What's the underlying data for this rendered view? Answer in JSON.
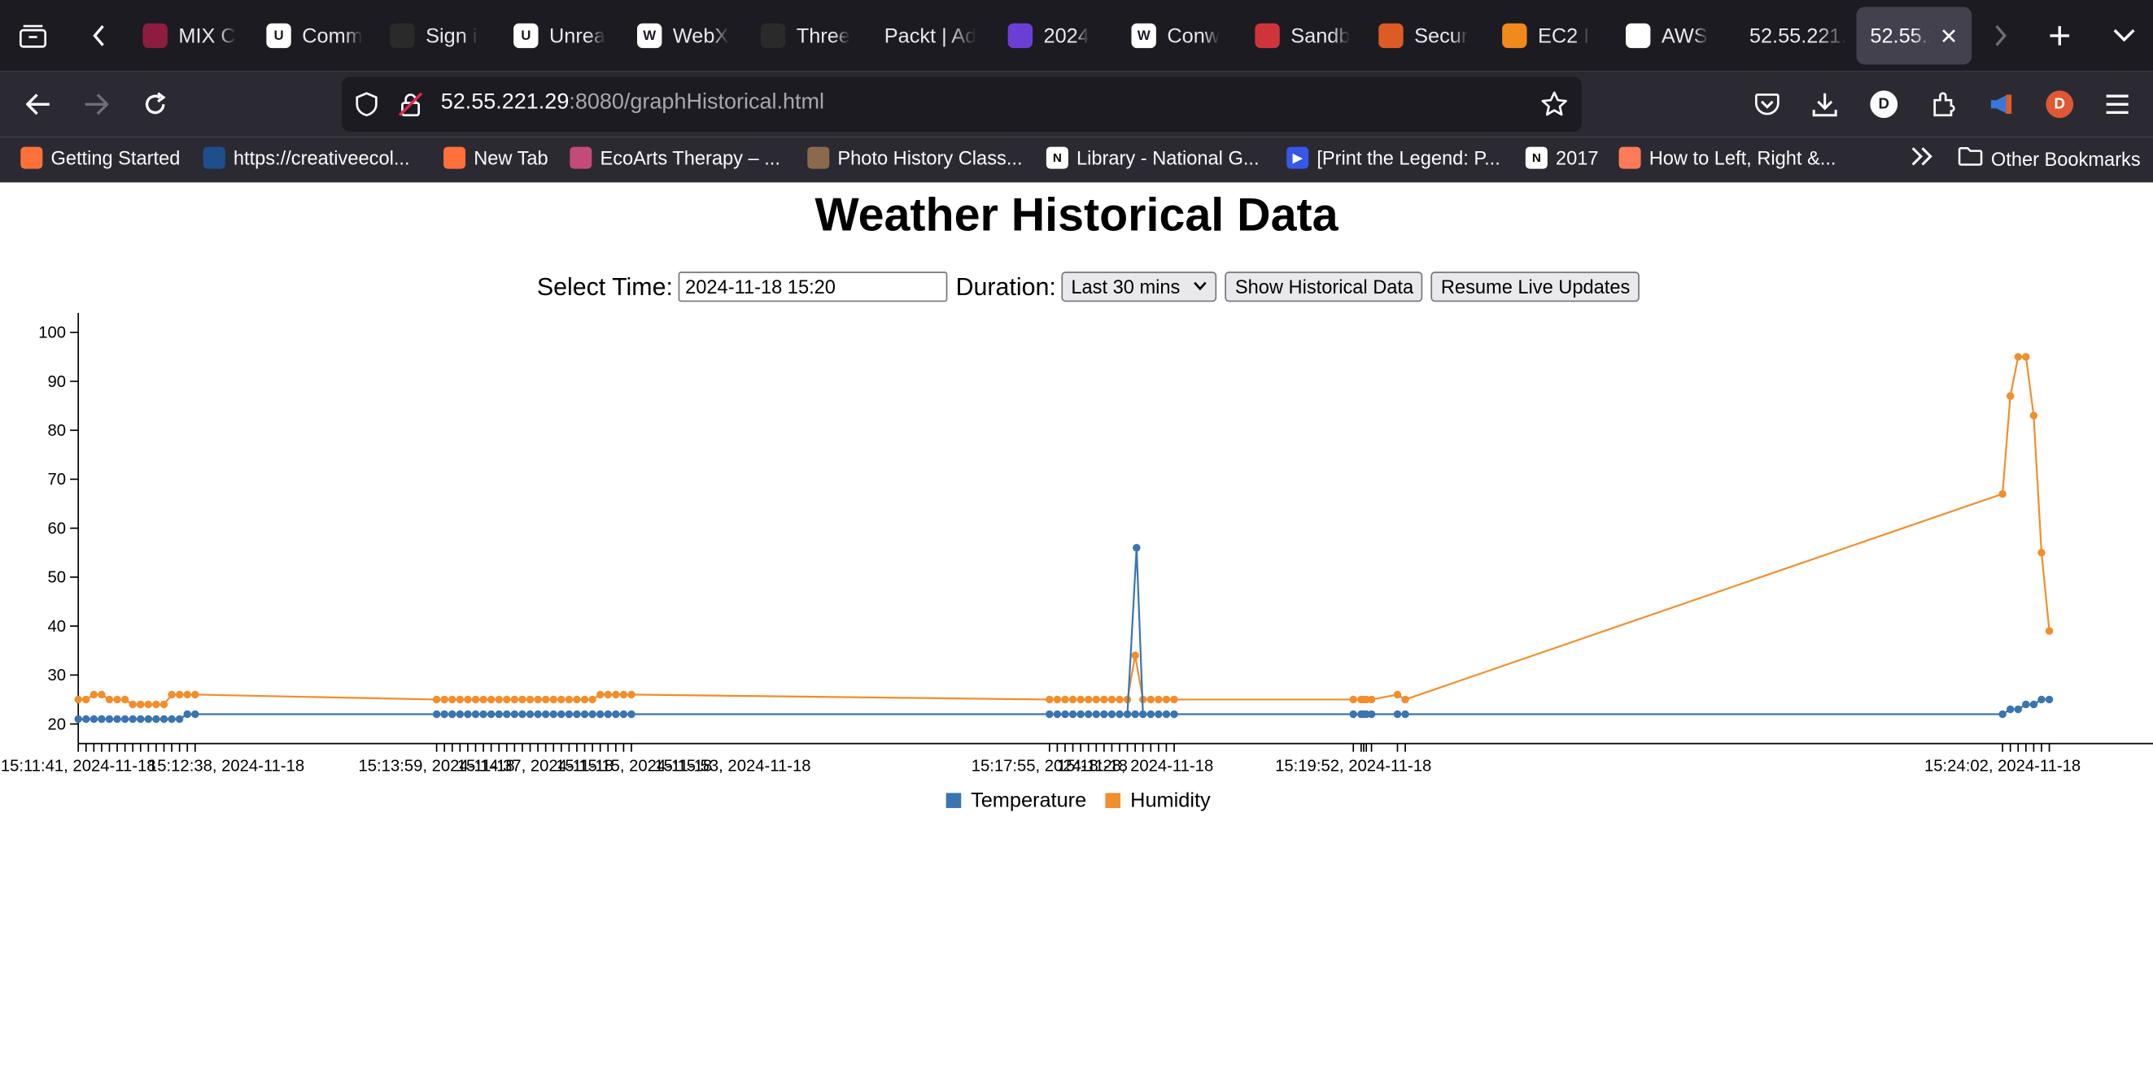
{
  "browser": {
    "tabs": [
      {
        "label": "MIX C",
        "favicon": "asu-icon",
        "color": "#8c1d40"
      },
      {
        "label": "Comm",
        "favicon": "unreal-icon",
        "color": "#ffffff"
      },
      {
        "label": "Sign i",
        "favicon": "epic-icon",
        "color": "#2a2a2a"
      },
      {
        "label": "Unrea",
        "favicon": "unreal-icon",
        "color": "#ffffff"
      },
      {
        "label": "WebX",
        "favicon": "wikipedia-icon",
        "color": "#ffffff"
      },
      {
        "label": "Three",
        "favicon": "threejs-icon",
        "color": "#2a2a2a"
      },
      {
        "label": "Packt | Ad",
        "favicon": "",
        "color": ""
      },
      {
        "label": "2024",
        "favicon": "list-icon",
        "color": "#6b3fd6"
      },
      {
        "label": "Conw",
        "favicon": "wikipedia-icon",
        "color": "#ffffff"
      },
      {
        "label": "Sandb",
        "favicon": "sandbox-icon",
        "color": "#d0343b"
      },
      {
        "label": "Secur",
        "favicon": "aws-icon",
        "color": "#dd5b25"
      },
      {
        "label": "EC2 I",
        "favicon": "ec2-icon",
        "color": "#f08a1c"
      },
      {
        "label": "AWS",
        "favicon": "openai-icon",
        "color": "#ffffff"
      },
      {
        "label": "52.55.221.",
        "favicon": "",
        "color": ""
      },
      {
        "label": "52.55.2",
        "favicon": "",
        "color": "",
        "active": true
      }
    ],
    "url_host": "52.55.221.29",
    "url_path": ":8080/graphHistorical.html",
    "profile_initial": "D",
    "bookmarks": [
      {
        "label": "Getting Started",
        "favicon": "firefox-icon",
        "color": "#ff7139"
      },
      {
        "label": "https://creativeecol...",
        "favicon": "ucsc-icon",
        "color": "#1f4e8c"
      },
      {
        "label": "New Tab",
        "favicon": "firefox-icon",
        "color": "#ff7139"
      },
      {
        "label": "EcoArts Therapy – ...",
        "favicon": "ecoarts-icon",
        "color": "#c44a7a"
      },
      {
        "label": "Photo History Class...",
        "favicon": "portrait-icon",
        "color": "#8a6a4a"
      },
      {
        "label": "Library - National G...",
        "favicon": "notion-icon",
        "color": "#ffffff"
      },
      {
        "label": "[Print the Legend: P...",
        "favicon": "play-icon",
        "color": "#3558e8"
      },
      {
        "label": "2017",
        "favicon": "notion-icon",
        "color": "#ffffff"
      },
      {
        "label": "How to Left, Right &...",
        "favicon": "hubspot-icon",
        "color": "#ff7a59"
      }
    ],
    "other_bookmarks": "Other Bookmarks"
  },
  "page": {
    "title": "Weather Historical Data",
    "select_time_label": "Select Time:",
    "select_time_value": "2024-11-18 15:20",
    "duration_label": "Duration:",
    "duration_value": "Last 30 mins",
    "show_button": "Show Historical Data",
    "resume_button": "Resume Live Updates"
  },
  "chart_data": {
    "type": "line",
    "title": "",
    "xlabel": "",
    "ylabel": "",
    "ylim": [
      16,
      104
    ],
    "yticks": [
      20,
      30,
      40,
      50,
      60,
      70,
      80,
      90,
      100
    ],
    "xlim": [
      "15:11:41",
      "15:24:52"
    ],
    "x_tick_labels": [
      {
        "t": "15:11:41",
        "label": "15:11:41, 2024-11-18"
      },
      {
        "t": "15:12:38",
        "label": "15:12:38, 2024-11-18"
      },
      {
        "t": "15:13:59",
        "label": "15:13:59, 2024-11-18"
      },
      {
        "t": "15:14:37",
        "label": "15:14:37, 2024-11-18"
      },
      {
        "t": "15:15:15",
        "label": "15:15:15, 2024-11-18"
      },
      {
        "t": "15:15:53",
        "label": "15:15:53, 2024-11-18"
      },
      {
        "t": "15:17:55",
        "label": "15:17:55, 2024-11-18"
      },
      {
        "t": "15:18:28",
        "label": "15:18:28, 2024-11-18"
      },
      {
        "t": "15:19:52",
        "label": "15:19:52, 2024-11-18"
      },
      {
        "t": "15:24:02",
        "label": "15:24:02, 2024-11-18"
      }
    ],
    "grid": false,
    "legend_position": "bottom-center",
    "x": [
      "15:11:41",
      "15:11:44",
      "15:11:47",
      "15:11:50",
      "15:11:53",
      "15:11:56",
      "15:11:59",
      "15:12:02",
      "15:12:05",
      "15:12:08",
      "15:12:11",
      "15:12:14",
      "15:12:17",
      "15:12:20",
      "15:12:23",
      "15:12:26",
      "15:13:59",
      "15:14:02",
      "15:14:05",
      "15:14:08",
      "15:14:11",
      "15:14:14",
      "15:14:17",
      "15:14:20",
      "15:14:23",
      "15:14:26",
      "15:14:29",
      "15:14:32",
      "15:14:35",
      "15:14:38",
      "15:14:41",
      "15:14:44",
      "15:14:47",
      "15:14:50",
      "15:14:53",
      "15:14:56",
      "15:14:59",
      "15:15:02",
      "15:15:05",
      "15:15:08",
      "15:15:11",
      "15:15:14",
      "15:17:55",
      "15:17:58",
      "15:18:01",
      "15:18:04",
      "15:18:07",
      "15:18:10",
      "15:18:13",
      "15:18:16",
      "15:18:19",
      "15:18:22",
      "15:18:25",
      "15:18:28",
      "15:18:31",
      "15:18:34",
      "15:18:37",
      "15:18:40",
      "15:18:43",
      "15:19:52",
      "15:19:55",
      "15:19:56",
      "15:19:57",
      "15:19:59",
      "15:20:09",
      "15:20:12",
      "15:24:02",
      "15:24:05",
      "15:24:08",
      "15:24:11",
      "15:24:14",
      "15:24:17",
      "15:24:20"
    ],
    "series": [
      {
        "name": "Temperature",
        "color": "#3a75b0",
        "values": [
          21,
          21,
          21,
          21,
          21,
          21,
          21,
          21,
          21,
          21,
          21,
          21,
          21,
          21,
          22,
          22,
          22,
          22,
          22,
          22,
          22,
          22,
          22,
          22,
          22,
          22,
          22,
          22,
          22,
          22,
          22,
          22,
          22,
          22,
          22,
          22,
          22,
          22,
          22,
          22,
          22,
          22,
          22,
          22,
          22,
          22,
          22,
          22,
          22,
          22,
          22,
          22,
          22,
          22,
          22,
          22,
          22,
          22,
          22,
          22,
          22,
          22,
          22,
          22,
          22,
          22,
          22,
          23,
          23,
          24,
          24,
          25,
          25
        ]
      },
      {
        "name": "Humidity",
        "color": "#f28e2b",
        "values": [
          25,
          25,
          26,
          26,
          25,
          25,
          25,
          24,
          24,
          24,
          24,
          24,
          26,
          26,
          26,
          26,
          25,
          25,
          25,
          25,
          25,
          25,
          25,
          25,
          25,
          25,
          25,
          25,
          25,
          25,
          25,
          25,
          25,
          25,
          25,
          25,
          25,
          26,
          26,
          26,
          26,
          26,
          25,
          25,
          25,
          25,
          25,
          25,
          25,
          25,
          25,
          25,
          25,
          34,
          25,
          25,
          25,
          25,
          25,
          25,
          25,
          25,
          25,
          25,
          26,
          25,
          67,
          87,
          95,
          95,
          83,
          55,
          39
        ]
      }
    ],
    "spike": {
      "series": "Temperature",
      "t": "15:18:28",
      "value": 56
    }
  }
}
